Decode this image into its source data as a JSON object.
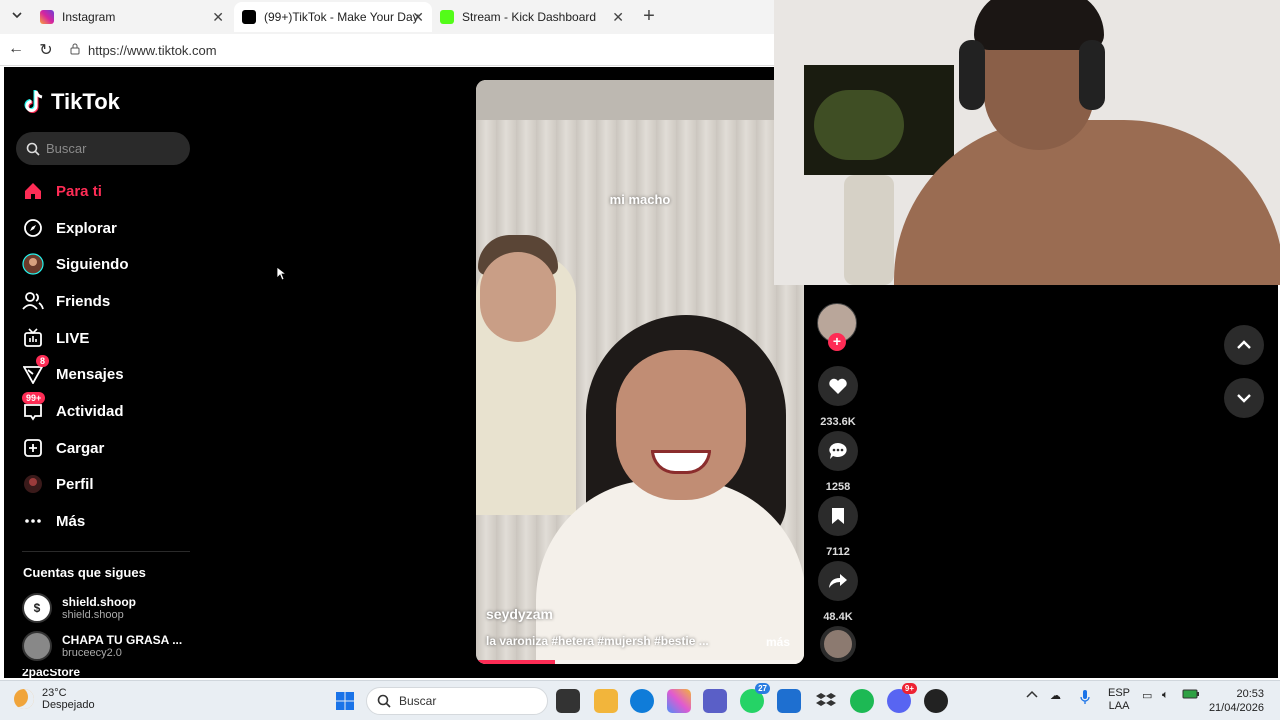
{
  "browser": {
    "tabs": [
      {
        "label": "Instagram",
        "active": false
      },
      {
        "label": "(99+)TikTok - Make Your Day",
        "active": true
      },
      {
        "label": "Stream - Kick Dashboard",
        "active": false
      }
    ],
    "url": "https://www.tiktok.com"
  },
  "tiktok": {
    "logo_text": "TikTok",
    "search_placeholder": "Buscar",
    "menu": [
      {
        "label": "Para ti",
        "icon": "home-icon",
        "active": true
      },
      {
        "label": "Explorar",
        "icon": "compass-icon"
      },
      {
        "label": "Siguiendo",
        "icon": "following-avatar-icon"
      },
      {
        "label": "Friends",
        "icon": "friends-icon"
      },
      {
        "label": "LIVE",
        "icon": "live-tv-icon"
      },
      {
        "label": "Mensajes",
        "icon": "paper-plane-icon",
        "badge": "8"
      },
      {
        "label": "Actividad",
        "icon": "inbox-icon",
        "badge": "99+"
      },
      {
        "label": "Cargar",
        "icon": "plus-square-icon"
      },
      {
        "label": "Perfil",
        "icon": "profile-avatar-icon"
      },
      {
        "label": "Más",
        "icon": "more-dots-icon"
      }
    ],
    "following_title": "Cuentas que sigues",
    "following": [
      {
        "name": "shield.shoop",
        "username": "shield.shoop",
        "avatar_letter": "$"
      },
      {
        "name": "CHAPA TU GRASA ...",
        "username": "bruceecy2.0",
        "avatar_letter": ""
      },
      {
        "name": "2pacStore",
        "username": "",
        "avatar_letter": ""
      }
    ],
    "video": {
      "overlay_text": "mi macho",
      "username": "seydyzam",
      "description": "la varoniza #hetera #mujersh #bestie ...",
      "more": "más",
      "progress": 0.24
    },
    "actions": {
      "likes": "233.6K",
      "comments": "1258",
      "saves": "7112",
      "shares": "48.4K"
    }
  },
  "taskbar": {
    "temperature": "23°C",
    "weather": "Despejado",
    "search_placeholder": "Buscar",
    "whatsapp_badge": "27",
    "discord_badge": "9+",
    "lang_top": "ESP",
    "lang_bottom": "LAA",
    "time": "20:53",
    "date": "21/04/2026"
  },
  "colors": {
    "tiktok_accent": "#fe2c55",
    "app_bg": "#000000",
    "taskbar_bg": "#e9eef3"
  }
}
